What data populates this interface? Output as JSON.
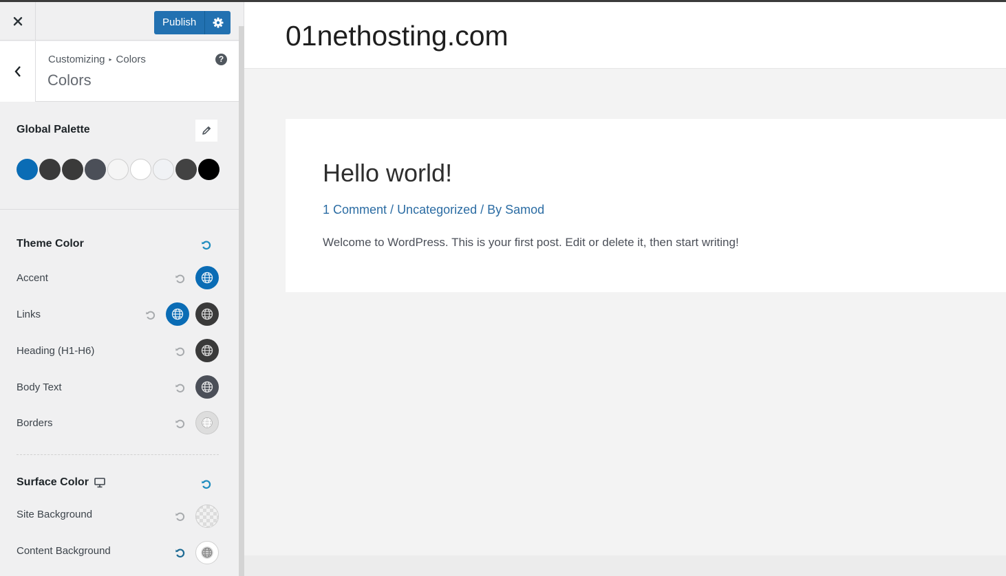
{
  "header": {
    "close_icon": "close-icon",
    "publish_label": "Publish",
    "settings_icon": "gear-icon"
  },
  "section": {
    "breadcrumb_root": "Customizing",
    "breadcrumb_separator": "▸",
    "breadcrumb_current": "Colors",
    "title": "Colors",
    "help_label": "?"
  },
  "palette": {
    "title": "Global Palette",
    "edit_icon": "pencil-icon",
    "colors": [
      "#0a6cb5",
      "#3a3a3a",
      "#3a3a3a",
      "#4b4f58",
      "#f5f5f5",
      "#ffffff",
      "#f0f2f5",
      "#424242",
      "#000000"
    ]
  },
  "theme_color": {
    "title": "Theme Color",
    "rows": [
      {
        "label": "Accent",
        "swatches": [
          "#0a6cb5"
        ]
      },
      {
        "label": "Links",
        "swatches": [
          "#0a6cb5",
          "#3a3a3a"
        ]
      },
      {
        "label": "Heading (H1-H6)",
        "swatches": [
          "#3a3a3a"
        ]
      },
      {
        "label": "Body Text",
        "swatches": [
          "#4b4f58"
        ]
      },
      {
        "label": "Borders",
        "swatches": [
          "#dddddd"
        ]
      }
    ]
  },
  "surface_color": {
    "title": "Surface Color",
    "device_icon": "desktop-icon",
    "rows": [
      {
        "label": "Site Background",
        "swatch": "transparent"
      },
      {
        "label": "Content Background",
        "swatch": "#ffffff"
      }
    ]
  },
  "preview": {
    "site_title": "01nethosting.com",
    "post": {
      "title": "Hello world!",
      "meta_comments": "1 Comment",
      "meta_sep1": " / ",
      "meta_category": "Uncategorized",
      "meta_sep2": " / By ",
      "meta_author": "Samod",
      "body": "Welcome to WordPress. This is your first post. Edit or delete it, then start writing!"
    }
  },
  "colors": {
    "accent": "#2271b1",
    "reset_active": "#1e8cbe"
  }
}
